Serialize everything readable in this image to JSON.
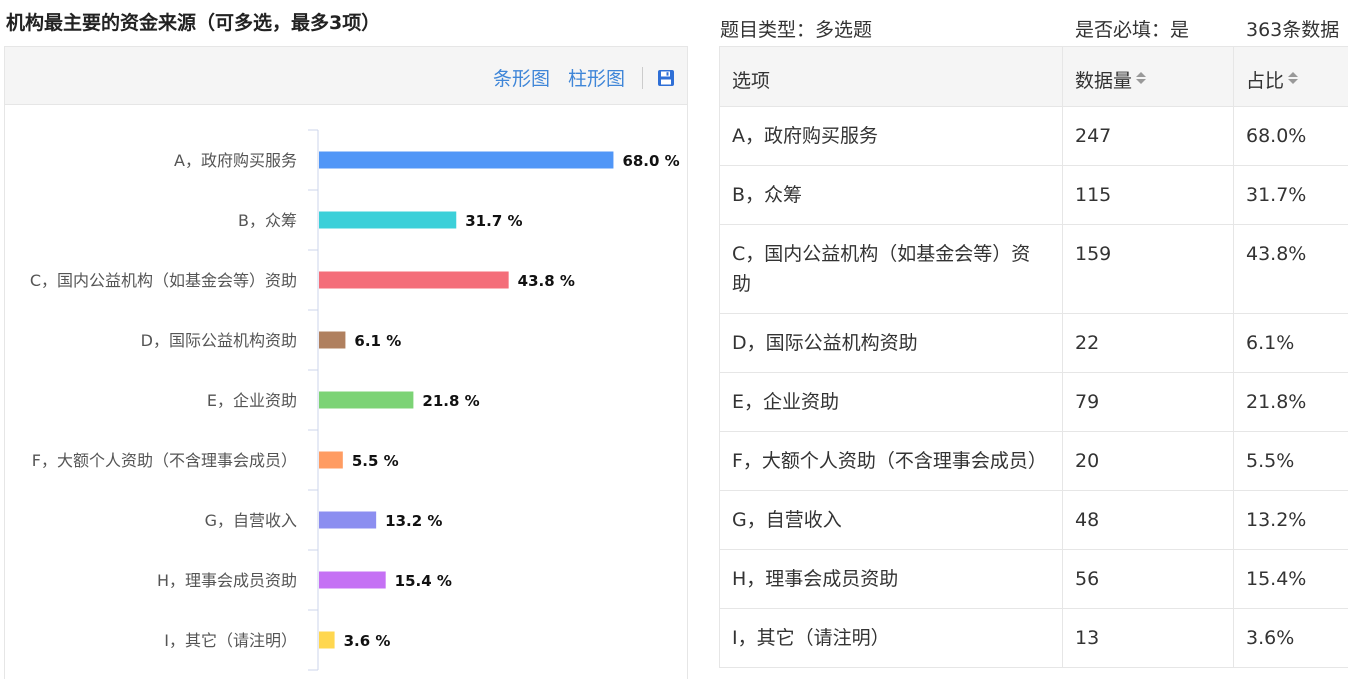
{
  "question": {
    "title": "机构最主要的资金来源（可多选，最多3项）"
  },
  "toolbar": {
    "bar_label": "条形图",
    "column_label": "柱形图",
    "save_icon": "save-icon"
  },
  "meta": {
    "type_text": "题目类型：多选题",
    "required_text": "是否必填：是",
    "count_text": "363条数据"
  },
  "table": {
    "headers": [
      "选项",
      "数据量",
      "占比"
    ],
    "rows": [
      {
        "option": "A，政府购买服务",
        "count": "247",
        "ratio": "68.0%"
      },
      {
        "option": "B，众筹",
        "count": "115",
        "ratio": "31.7%"
      },
      {
        "option": "C，国内公益机构（如基金会等）资助",
        "count": "159",
        "ratio": "43.8%"
      },
      {
        "option": "D，国际公益机构资助",
        "count": "22",
        "ratio": "6.1%"
      },
      {
        "option": "E，企业资助",
        "count": "79",
        "ratio": "21.8%"
      },
      {
        "option": "F，大额个人资助（不含理事会成员）",
        "count": "20",
        "ratio": "5.5%"
      },
      {
        "option": "G，自营收入",
        "count": "48",
        "ratio": "13.2%"
      },
      {
        "option": "H，理事会成员资助",
        "count": "56",
        "ratio": "15.4%"
      },
      {
        "option": "I，其它（请注明）",
        "count": "13",
        "ratio": "3.6%"
      }
    ]
  },
  "chart_data": {
    "type": "bar",
    "orientation": "horizontal",
    "categories": [
      "A，政府购买服务",
      "B，众筹",
      "C，国内公益机构（如基金会等）资助",
      "D，国际公益机构资助",
      "E，企业资助",
      "F，大额个人资助（不含理事会成员）",
      "G，自营收入",
      "H，理事会成员资助",
      "I，其它（请注明）"
    ],
    "values": [
      68.0,
      31.7,
      43.8,
      6.1,
      21.8,
      5.5,
      13.2,
      15.4,
      3.6
    ],
    "value_labels": [
      "68.0 %",
      "31.7 %",
      "43.8 %",
      "6.1 %",
      "21.8 %",
      "5.5 %",
      "13.2 %",
      "15.4 %",
      "3.6 %"
    ],
    "colors": [
      "#5096f7",
      "#3cd0d9",
      "#f46e7a",
      "#b0805f",
      "#7cd375",
      "#ff9c62",
      "#8c8ef0",
      "#c571f4",
      "#ffd74f"
    ],
    "xlim": [
      0,
      100
    ],
    "grid": false,
    "legend": "none"
  }
}
